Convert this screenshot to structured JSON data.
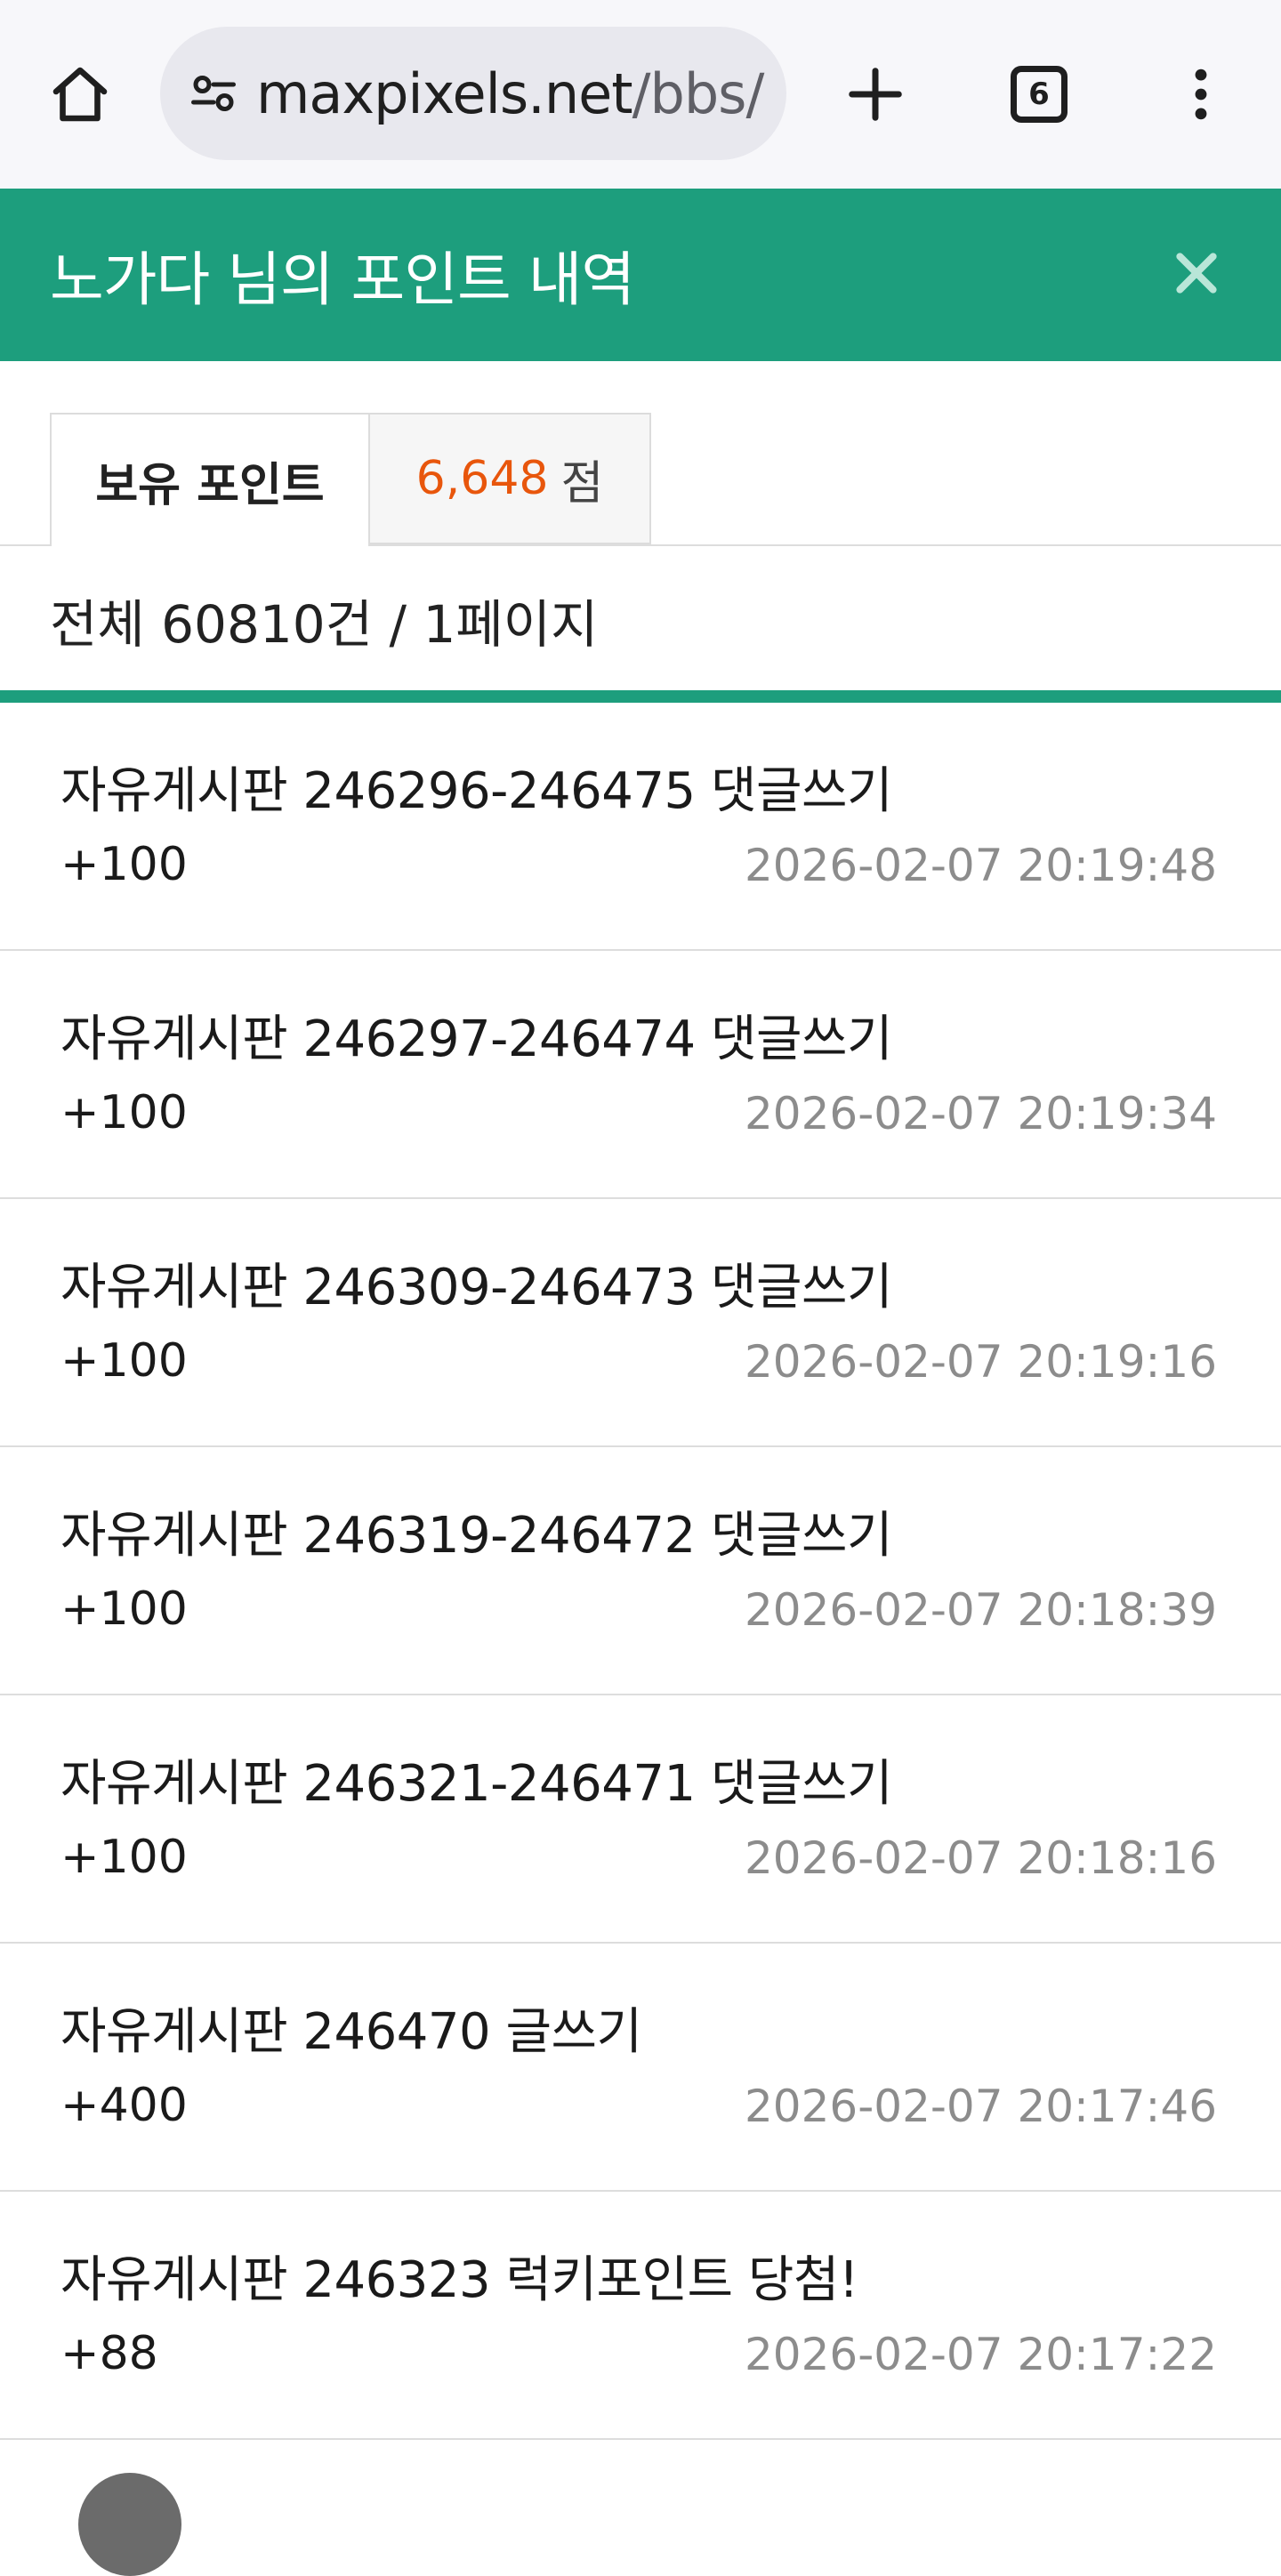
{
  "browser": {
    "url_host": "maxpixels.net",
    "url_path": "/bbs/",
    "tab_count": "6"
  },
  "header": {
    "title": "노가다 님의 포인트 내역"
  },
  "points": {
    "label": "보유 포인트",
    "value": "6,648",
    "unit": "점"
  },
  "summary": {
    "text": "전체 60810건 / 1페이지"
  },
  "items": [
    {
      "title": "자유게시판 246296-246475 댓글쓰기",
      "amount": "+100",
      "date": "2026-02-07 20:19:48"
    },
    {
      "title": "자유게시판 246297-246474 댓글쓰기",
      "amount": "+100",
      "date": "2026-02-07 20:19:34"
    },
    {
      "title": "자유게시판 246309-246473 댓글쓰기",
      "amount": "+100",
      "date": "2026-02-07 20:19:16"
    },
    {
      "title": "자유게시판 246319-246472 댓글쓰기",
      "amount": "+100",
      "date": "2026-02-07 20:18:39"
    },
    {
      "title": "자유게시판 246321-246471 댓글쓰기",
      "amount": "+100",
      "date": "2026-02-07 20:18:16"
    },
    {
      "title": "자유게시판 246470 글쓰기",
      "amount": "+400",
      "date": "2026-02-07 20:17:46"
    },
    {
      "title": "자유게시판 246323 럭키포인트 당첨!",
      "amount": "+88",
      "date": "2026-02-07 20:17:22"
    }
  ],
  "colors": {
    "accent": "#1d9e7d",
    "points_value": "#e8560c",
    "date_text": "#8c8c8c"
  },
  "icons": {
    "home": "home-icon",
    "site_info": "site-settings-icon",
    "new_tab": "plus-icon",
    "tabs": "tab-switcher-icon",
    "menu": "more-vert-icon",
    "close": "close-icon"
  }
}
